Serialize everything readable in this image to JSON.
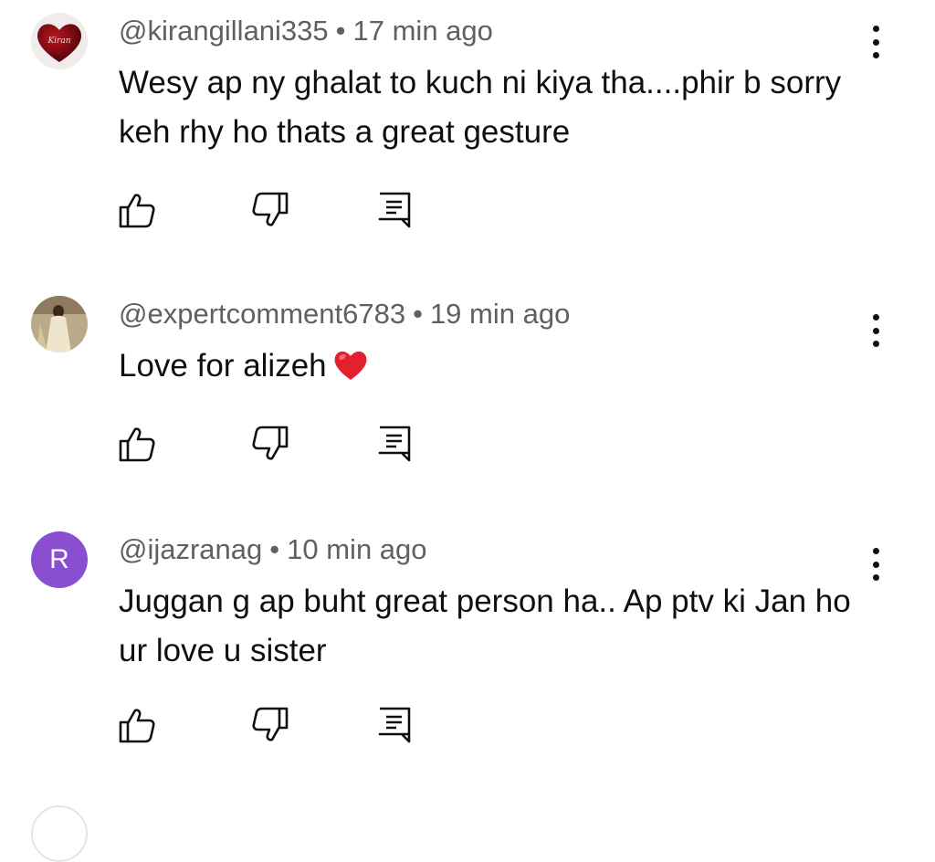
{
  "comments": [
    {
      "handle": "@kirangillani335",
      "separator": "•",
      "time": "17 min ago",
      "text": "Wesy ap ny ghalat to kuch ni kiya tha....phir b sorry keh rhy ho thats a great gesture",
      "avatar": {
        "type": "image",
        "label": "Kiran"
      }
    },
    {
      "handle": "@expertcomment6783",
      "separator": "•",
      "time": "19 min ago",
      "text": "Love for alizeh",
      "emoji": "red-heart-icon",
      "avatar": {
        "type": "image"
      }
    },
    {
      "handle": "@ijazranag",
      "separator": "•",
      "time": "10 min ago",
      "text": "Juggan g ap buht great person ha.. Ap ptv ki Jan ho ur love u sister",
      "avatar": {
        "type": "initial",
        "letter": "R",
        "color": "#8a4fd0"
      }
    }
  ],
  "colors": {
    "meta": "#606060",
    "text": "#0f0f0f",
    "heart": "#e5202e"
  }
}
